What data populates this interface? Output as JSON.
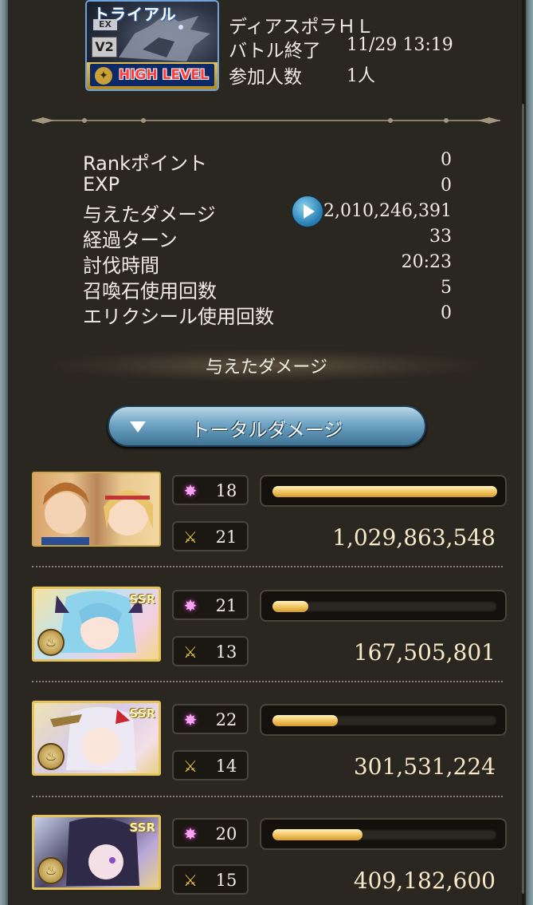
{
  "quest": {
    "trial_label": "トライアル",
    "ex_label": "EX",
    "version_label": "V2",
    "level_label": "HIGH LEVEL",
    "name": "ディアスポラＨＬ",
    "end_label": "バトル終了",
    "end_time": "11/29 13:19",
    "participants_label": "参加人数",
    "participants_value": "1人"
  },
  "stats": [
    {
      "label": "Rankポイント",
      "value": "0"
    },
    {
      "label": "EXP",
      "value": "0"
    },
    {
      "label": "与えたダメージ",
      "value": "2,010,246,391"
    },
    {
      "label": "経過ターン",
      "value": "33"
    },
    {
      "label": "討伐時間",
      "value": "20:23"
    },
    {
      "label": "召喚石使用回数",
      "value": "5"
    },
    {
      "label": "エリクシール使用回数",
      "value": "0"
    }
  ],
  "section_title": "与えたダメージ",
  "total_damage_button": "トータルダメージ",
  "ssr_label": "SSR",
  "members": [
    {
      "stat1": "18",
      "stat2": "21",
      "damage": "1,029,863,548",
      "fill": 1.0
    },
    {
      "stat1": "21",
      "stat2": "13",
      "damage": "167,505,801",
      "fill": 0.16
    },
    {
      "stat1": "22",
      "stat2": "14",
      "damage": "301,531,224",
      "fill": 0.29
    },
    {
      "stat1": "20",
      "stat2": "15",
      "damage": "409,182,600",
      "fill": 0.4
    }
  ],
  "icons": {
    "star": "sparkle-icon",
    "cross": "crossed-swords-icon",
    "play": "play-icon",
    "element": "fire-element-icon"
  },
  "colors": {
    "bar": "#f5cb6a",
    "frame": "#8fa6ab",
    "button": "#6fa3c4"
  }
}
